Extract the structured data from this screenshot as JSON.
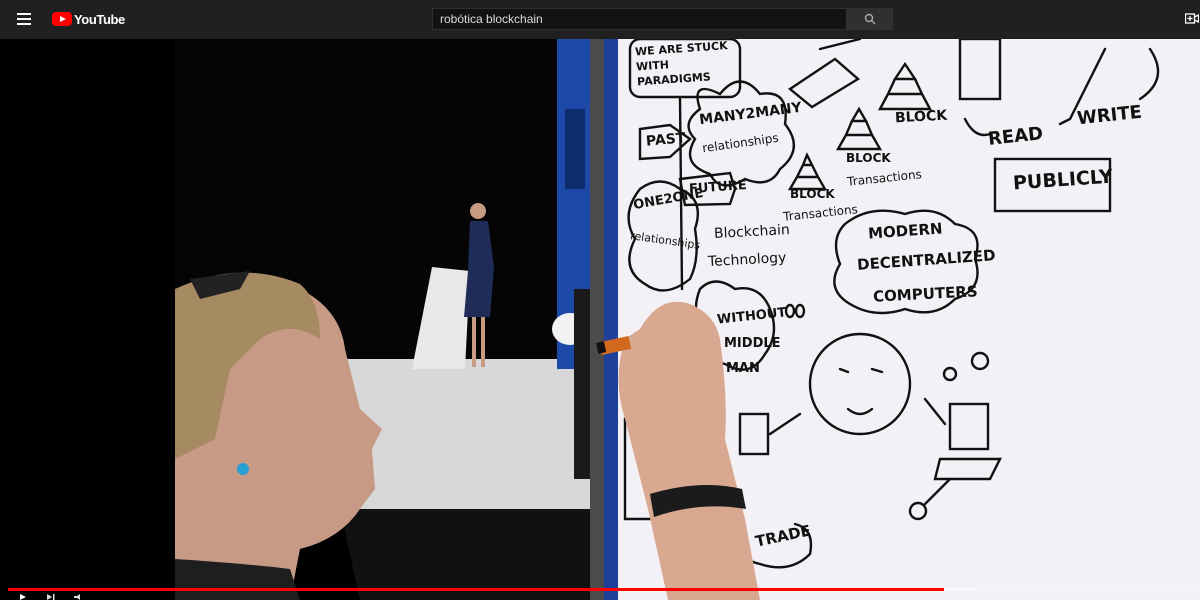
{
  "header": {
    "menu_icon": "hamburger-menu-icon",
    "logo_text": "YouTube",
    "search": {
      "value": "robótica blockchain",
      "icon": "search-icon"
    },
    "create_icon": "create-video-icon"
  },
  "player": {
    "progress_played": 0.785,
    "progress_buffered": 0.81,
    "controls": [
      "play-icon",
      "next-icon",
      "volume-icon"
    ]
  },
  "whiteboard": {
    "past_note": "WE ARE STUCK WITH PARADIGMS",
    "past": "PAST",
    "future": "FUTURE",
    "many2many": "MANY2MANY",
    "many_rel": "relationships",
    "one2one": "ONE2ONE",
    "one_rel": "relationships",
    "blockchain": "Blockchain",
    "technology": "Technology",
    "block_1": "BLOCK",
    "transactions_1": "Transactions",
    "block_2": "BLOCK",
    "transactions_2": "Transactions",
    "block_3": "BLOCK",
    "read": "READ",
    "write": "WRITE",
    "publicly": "PUBLICLY",
    "modern_1": "MODERN",
    "modern_2": "DECENTRALIZED",
    "modern_3": "COMPUTERS",
    "without": "WITHOUT",
    "middle": "MIDDLE",
    "man": "MAN",
    "trade": "TRADE"
  },
  "colors": {
    "topbar": "#202020",
    "brand": "#ff0000",
    "whiteboard": "#f4f1f6",
    "stage_blue": "#1d4aa8"
  }
}
